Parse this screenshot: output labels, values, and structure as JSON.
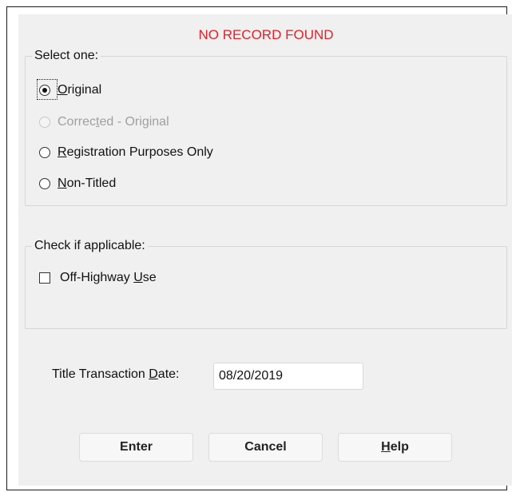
{
  "dialog": {
    "status_message": "NO RECORD FOUND"
  },
  "select_group": {
    "legend": "Select one:",
    "options": [
      {
        "pre": "",
        "u": "O",
        "post": "riginal",
        "checked": true,
        "disabled": false
      },
      {
        "pre": "Correc",
        "u": "t",
        "post": "ed - Original",
        "checked": false,
        "disabled": true
      },
      {
        "pre": "",
        "u": "R",
        "post": "egistration Purposes Only",
        "checked": false,
        "disabled": false
      },
      {
        "pre": "",
        "u": "N",
        "post": "on-Titled",
        "checked": false,
        "disabled": false
      }
    ]
  },
  "check_group": {
    "legend": "Check if applicable:",
    "off_highway": {
      "pre": "Off-Highway ",
      "u": "U",
      "post": "se",
      "checked": false
    }
  },
  "date": {
    "label_pre": "Title Transaction ",
    "label_u": "D",
    "label_post": "ate:",
    "value": "08/20/2019"
  },
  "buttons": {
    "enter": "Enter",
    "cancel": "Cancel",
    "help_u": "H",
    "help_post": "elp"
  }
}
